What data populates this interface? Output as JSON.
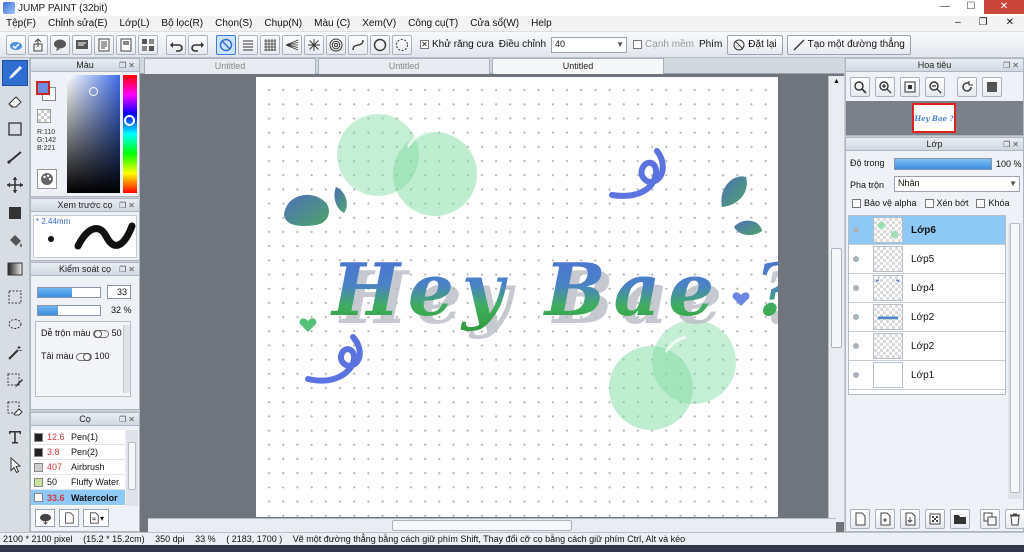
{
  "window": {
    "title": "JUMP PAINT (32bit)"
  },
  "menu": [
    "Tệp(F)",
    "Chỉnh sửa(E)",
    "Lớp(L)",
    "Bộ lọc(R)",
    "Chọn(S)",
    "Chụp(N)",
    "Màu (C)",
    "Xem(V)",
    "Công cụ(T)",
    "Cửa sổ(W)",
    "Help"
  ],
  "toolbar": {
    "antialias_label": "Khử răng cưa",
    "adjust_label": "Điều chỉnh",
    "adjust_value": "40",
    "edge_label": "Cạnh mềm",
    "key_label": "Phím",
    "reset_label": "Đặt lại",
    "line_label": "Tạo một đường thẳng"
  },
  "color_panel": {
    "title": "Màu",
    "r": "R:110",
    "g": "G:142",
    "b": "B:221",
    "fg_color": "#6e8edd",
    "bg_color": "#ffffff"
  },
  "brush_preview": {
    "title": "Xem trước cọ",
    "size": "2.44mm"
  },
  "brush_control": {
    "title": "Kiểm soát cọ",
    "size_value": "33",
    "opacity_value": "32 %",
    "blend_label": "Dễ trộn màu",
    "blend_value": "50",
    "color_amount_label": "Tải màu",
    "color_amount_value": "100"
  },
  "brush_list": {
    "title": "Cọ",
    "items": [
      {
        "size": "12.6",
        "name": "Pen(1)",
        "swatch": "#222222"
      },
      {
        "size": "3.8",
        "name": "Pen(2)",
        "swatch": "#222222"
      },
      {
        "size": "407",
        "name": "Airbrush",
        "swatch": "#cccccc"
      },
      {
        "size": "50",
        "name": "Fluffy Water",
        "swatch": "#c8e6a0"
      },
      {
        "size": "33.6",
        "name": "Watercolor",
        "swatch": "#ffffff"
      }
    ]
  },
  "tabs": [
    "Untitled",
    "Untitled",
    "Untitled"
  ],
  "artwork": {
    "text": "Hey Bae ?"
  },
  "navigator": {
    "title": "Hoa tiêu"
  },
  "layers": {
    "title": "Lớp",
    "opacity_label": "Độ trong",
    "opacity_value": "100 %",
    "blend_label": "Pha trộn",
    "blend_value": "Nhân",
    "protect_alpha": "Bảo vệ alpha",
    "clip": "Xén bớt",
    "lock": "Khóa",
    "items": [
      "Lớp6",
      "Lớp5",
      "Lớp4",
      "Lớp2",
      "Lớp2",
      "Lớp1"
    ]
  },
  "status": {
    "size": "2100 * 2100 pixel",
    "cm": "(15.2 * 15.2cm)",
    "dpi": "350 dpi",
    "zoom": "33 %",
    "coords": "( 2183, 1700 )",
    "hint": "Vẽ một đường thẳng bằng cách giữ phím Shift, Thay đổi cỡ cọ bằng cách giữ phím Ctrl, Alt và kéo"
  }
}
